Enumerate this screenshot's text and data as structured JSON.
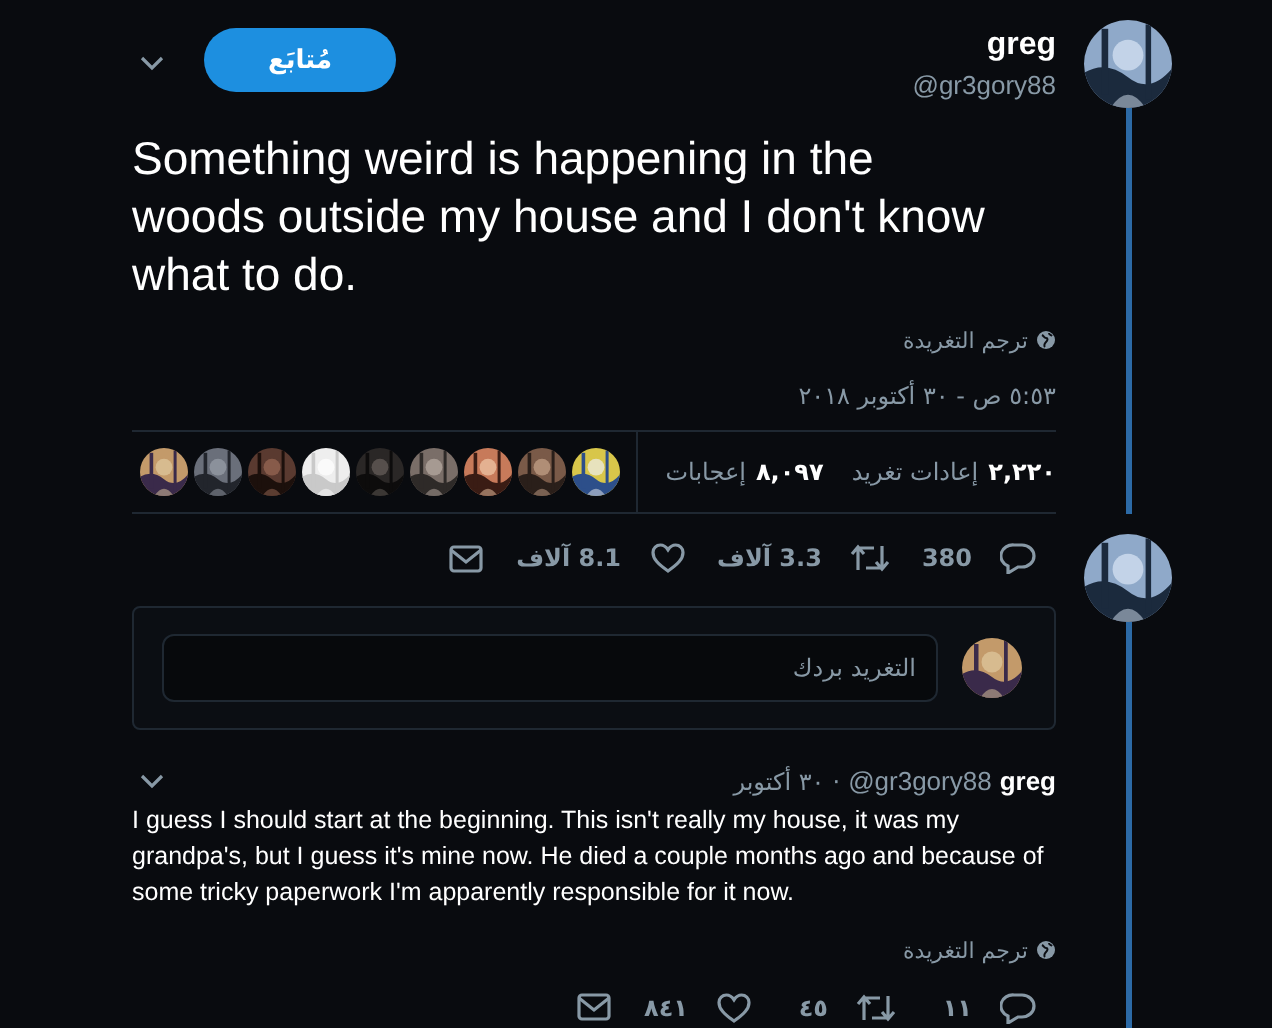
{
  "tweet": {
    "name": "greg",
    "handle": "@gr3gory88",
    "follow_button": {
      "label": "مُتابَع",
      "selected": true
    },
    "text": "Something weird is happening in the woods outside my house and I don't know what to do.",
    "translate": "ترجم التغريدة",
    "timestamp": "٥:٥٣ ص - ٣٠ أكتوبر ٢٠١٨",
    "stats": [
      {
        "count": "٢,٢٢٠",
        "label": "إعادات تغريد"
      },
      {
        "count": "٨,٠٩٧",
        "label": "إعجابات"
      }
    ],
    "actions": [
      {
        "kind": "reply",
        "count": "380"
      },
      {
        "kind": "retweet",
        "count": "3.3 آلاف"
      },
      {
        "kind": "like",
        "count": "8.1 آلاف"
      },
      {
        "kind": "message"
      }
    ]
  },
  "reply_box": {
    "placeholder": "التغريد بردك"
  },
  "reply": {
    "name": "greg",
    "handle": "@gr3gory88",
    "separator": "·",
    "date": "٣٠ أكتوبر",
    "text": "I guess I should start at the beginning. This isn't really my house, it was my grandpa's, but I guess it's mine now. He died a couple months ago and because of some tricky paperwork I'm apparently responsible for it now.",
    "translate": "ترجم التغريدة",
    "actions": [
      {
        "kind": "reply",
        "count": "١١"
      },
      {
        "kind": "retweet",
        "count": "٤٥"
      },
      {
        "kind": "like",
        "count": "٨٤١"
      },
      {
        "kind": "message"
      }
    ]
  }
}
